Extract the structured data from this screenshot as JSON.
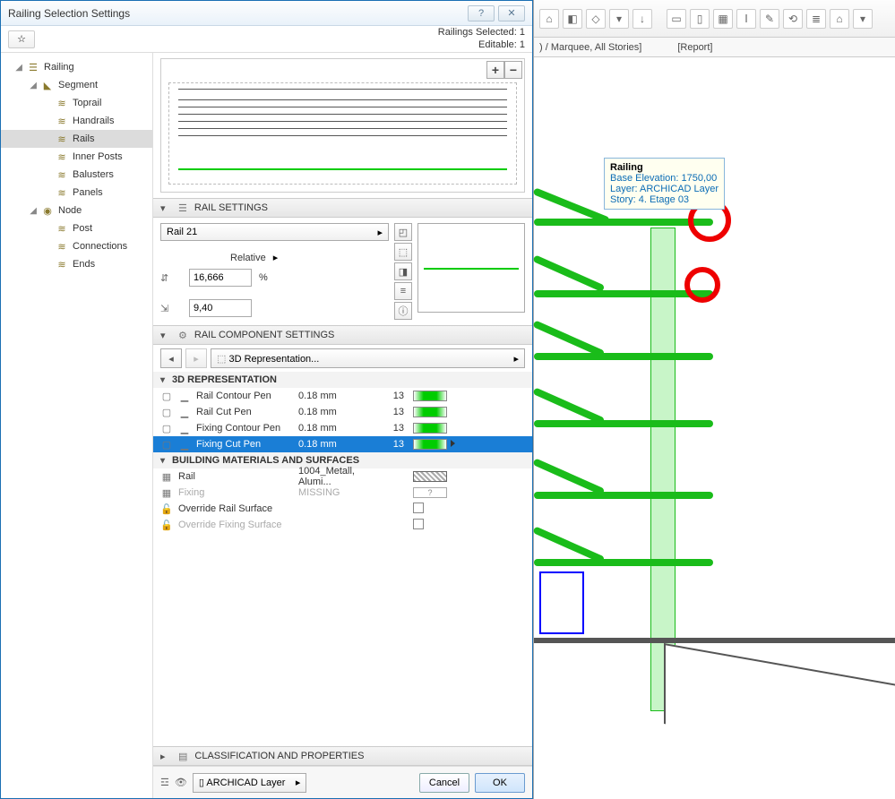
{
  "dialog": {
    "title": "Railing Selection Settings",
    "selected_label": "Railings Selected: 1",
    "editable_label": "Editable: 1"
  },
  "tree": {
    "items": [
      {
        "label": "Railing",
        "level": 0,
        "expanded": true,
        "icon": "railing"
      },
      {
        "label": "Segment",
        "level": 1,
        "expanded": true,
        "icon": "segment"
      },
      {
        "label": "Toprail",
        "level": 2,
        "icon": "rail"
      },
      {
        "label": "Handrails",
        "level": 2,
        "icon": "rail"
      },
      {
        "label": "Rails",
        "level": 2,
        "icon": "rail",
        "selected": true
      },
      {
        "label": "Inner Posts",
        "level": 2,
        "icon": "rail"
      },
      {
        "label": "Balusters",
        "level": 2,
        "icon": "rail"
      },
      {
        "label": "Panels",
        "level": 2,
        "icon": "rail"
      },
      {
        "label": "Node",
        "level": 1,
        "expanded": true,
        "icon": "node"
      },
      {
        "label": "Post",
        "level": 2,
        "icon": "rail"
      },
      {
        "label": "Connections",
        "level": 2,
        "icon": "rail"
      },
      {
        "label": "Ends",
        "level": 2,
        "icon": "rail"
      }
    ]
  },
  "sections": {
    "rail_settings": "RAIL SETTINGS",
    "rail_component": "RAIL COMPONENT SETTINGS",
    "classification": "CLASSIFICATION AND PROPERTIES"
  },
  "rail_settings": {
    "rail_name": "Rail 21",
    "relative_label": "Relative",
    "relative_value": "16,666",
    "relative_unit": "%",
    "height_value": "9,40"
  },
  "nav": {
    "repr_label": "3D Representation..."
  },
  "repr3d": {
    "header": "3D REPRESENTATION",
    "rows": [
      {
        "label": "Rail Contour Pen",
        "size": "0.18 mm",
        "pen": "13"
      },
      {
        "label": "Rail Cut Pen",
        "size": "0.18 mm",
        "pen": "13"
      },
      {
        "label": "Fixing Contour Pen",
        "size": "0.18 mm",
        "pen": "13"
      },
      {
        "label": "Fixing Cut Pen",
        "size": "0.18 mm",
        "pen": "13",
        "selected": true
      }
    ]
  },
  "materials": {
    "header": "BUILDING MATERIALS AND SURFACES",
    "rows": [
      {
        "label": "Rail",
        "value": "1004_Metall, Alumi...",
        "swatch": "hatch"
      },
      {
        "label": "Fixing",
        "value": "MISSING",
        "swatch": "q",
        "inactive": true
      },
      {
        "label": "Override Rail Surface",
        "checkbox": true
      },
      {
        "label": "Override Fixing Surface",
        "checkbox": true,
        "inactive": true
      }
    ]
  },
  "footer": {
    "layer": "ARCHICAD Layer",
    "cancel": "Cancel",
    "ok": "OK"
  },
  "bg": {
    "tabs_left": ") / Marquee, All Stories]",
    "tabs_right": "[Report]",
    "tooltip": {
      "title": "Railing",
      "l1": "Base Elevation: 1750,00",
      "l2": "Layer: ARCHICAD Layer",
      "l3": "Story: 4. Etage 03"
    }
  }
}
